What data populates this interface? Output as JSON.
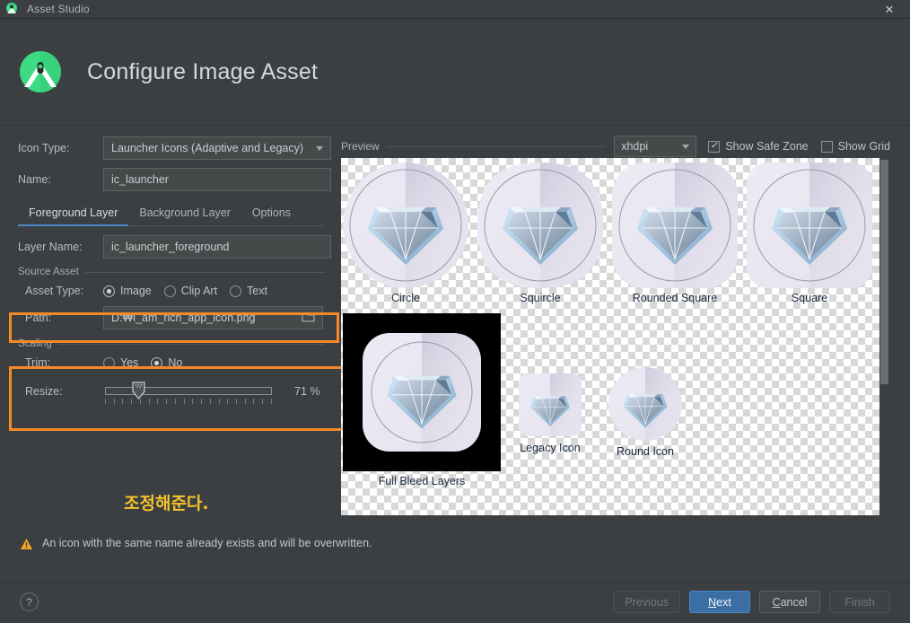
{
  "window": {
    "app_icon": "android-studio-icon",
    "title": "Asset Studio",
    "close_label": "✕"
  },
  "header": {
    "logo": "android-logo-icon",
    "title": "Configure Image Asset"
  },
  "form": {
    "icon_type": {
      "label": "Icon Type:",
      "value": "Launcher Icons (Adaptive and Legacy)"
    },
    "name": {
      "label": "Name:",
      "value": "ic_launcher"
    },
    "tabs": [
      {
        "label": "Foreground Layer",
        "active": true
      },
      {
        "label": "Background Layer",
        "active": false
      },
      {
        "label": "Options",
        "active": false
      }
    ],
    "layer_name": {
      "label": "Layer Name:",
      "value": "ic_launcher_foreground"
    },
    "source_asset": {
      "group_label": "Source Asset",
      "asset_type": {
        "label": "Asset Type:",
        "options": [
          "Image",
          "Clip Art",
          "Text"
        ],
        "selected": "Image"
      },
      "path": {
        "label": "Path:",
        "value": "D:₩i_am_rich_app_icon.png",
        "browse_icon": "folder-icon"
      }
    },
    "scaling": {
      "group_label": "Scaling",
      "trim": {
        "label": "Trim:",
        "options": [
          "Yes",
          "No"
        ],
        "selected": "No"
      },
      "resize": {
        "label": "Resize:",
        "percent": "71 %",
        "value": 71,
        "min": 0,
        "max": 400
      }
    }
  },
  "annotation": {
    "text": "조정해준다.",
    "color": "#F5C32C"
  },
  "highlights": {
    "color": "#F68927"
  },
  "preview": {
    "label": "Preview",
    "density": {
      "value": "xhdpi"
    },
    "show_safe_zone": {
      "label": "Show Safe Zone",
      "checked": true,
      "mark": "✓"
    },
    "show_grid": {
      "label": "Show Grid",
      "checked": false,
      "mark": ""
    },
    "items": [
      {
        "caption": "Circle",
        "shape": "circle"
      },
      {
        "caption": "Squircle",
        "shape": "squircle"
      },
      {
        "caption": "Rounded Square",
        "shape": "rounded-square"
      },
      {
        "caption": "Square",
        "shape": "square"
      },
      {
        "caption": "Full Bleed Layers",
        "shape": "full-bleed"
      },
      {
        "caption": "Legacy Icon",
        "shape": "legacy"
      },
      {
        "caption": "Round Icon",
        "shape": "round"
      }
    ]
  },
  "warning": {
    "icon": "warning-triangle-icon",
    "text": "An icon with the same name already exists and will be overwritten."
  },
  "footer": {
    "help": "?",
    "buttons": [
      {
        "label": "Previous",
        "state": "disabled"
      },
      {
        "label": "Next",
        "state": "primary",
        "mnemonic": "N"
      },
      {
        "label": "Cancel",
        "state": "normal",
        "mnemonic": "C"
      },
      {
        "label": "Finish",
        "state": "disabled"
      }
    ]
  }
}
